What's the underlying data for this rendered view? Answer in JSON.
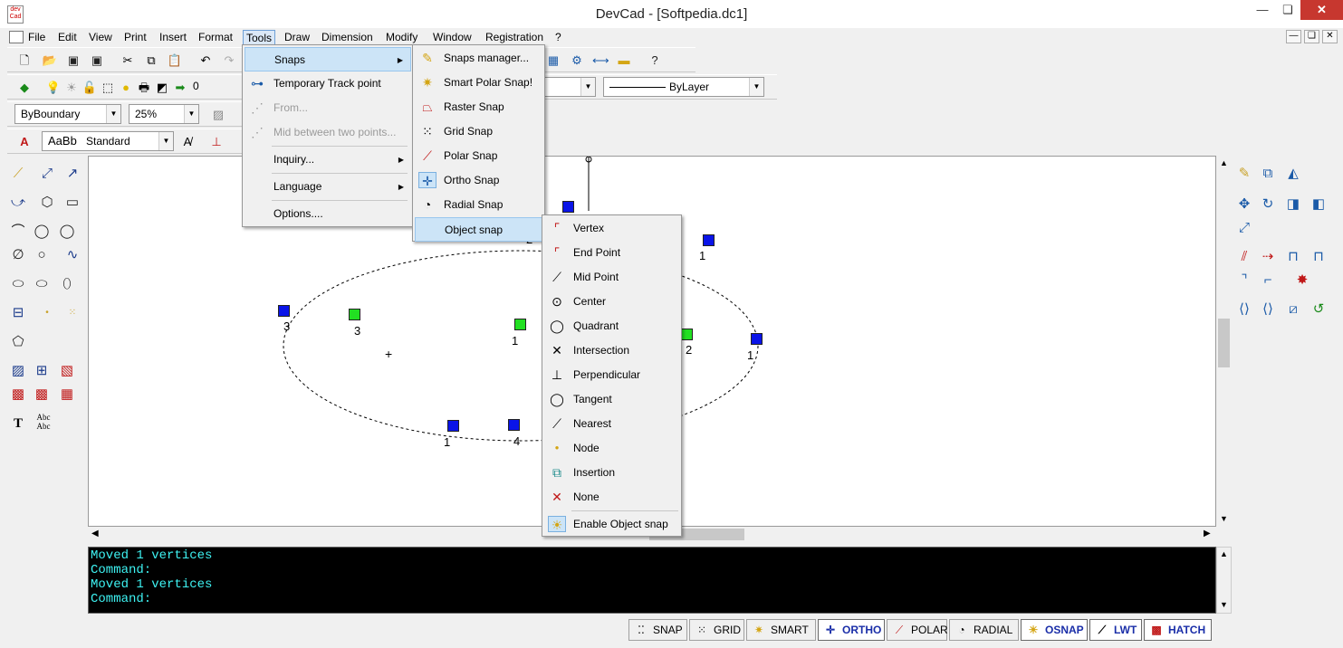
{
  "window": {
    "title": "DevCad - [Softpedia.dc1]",
    "app_icon_text": "dev\nCad"
  },
  "window_controls": {
    "minimize": "—",
    "restore": "❏",
    "close": "✕"
  },
  "mdi_controls": {
    "minimize": "—",
    "restore": "❏",
    "close": "✕"
  },
  "menu": [
    "File",
    "Edit",
    "View",
    "Print",
    "Insert",
    "Format",
    "Tools",
    "Draw",
    "Dimension",
    "Modify",
    "Window",
    "Registration",
    "?"
  ],
  "toolbar": {
    "layer_value": "0",
    "linetype_value": "ByLayer",
    "color_value": "r",
    "boundary_value": "ByBoundary",
    "zoom_value": "25%",
    "text_style_preview": "AaBb",
    "text_style_value": "Standard"
  },
  "tools_menu": {
    "items": [
      {
        "label": "Snaps",
        "icon": "snaps-icon",
        "submenu": true,
        "highlighted": true
      },
      {
        "label": "Temporary Track point",
        "icon": "track-point-icon"
      },
      {
        "label": "From...",
        "icon": "from-icon",
        "disabled": true
      },
      {
        "label": "Mid between two points...",
        "icon": "mid-between-icon",
        "disabled": true
      },
      {
        "label": "Inquiry...",
        "submenu": true
      },
      {
        "label": "Language",
        "submenu": true
      },
      {
        "label": "Options...."
      }
    ]
  },
  "snaps_menu": {
    "items": [
      {
        "label": "Snaps manager...",
        "icon": "snaps-manager-icon"
      },
      {
        "label": "Smart Polar Snap!",
        "icon": "smart-polar-icon"
      },
      {
        "label": "Raster Snap",
        "icon": "raster-snap-icon"
      },
      {
        "label": "Grid Snap",
        "icon": "grid-snap-icon"
      },
      {
        "label": "Polar Snap",
        "icon": "polar-snap-icon"
      },
      {
        "label": "Ortho Snap",
        "icon": "ortho-snap-icon"
      },
      {
        "label": "Radial Snap",
        "icon": "radial-snap-icon"
      },
      {
        "label": "Object snap",
        "submenu": true,
        "highlighted": true
      }
    ]
  },
  "osnap_menu": {
    "items": [
      {
        "label": "Vertex",
        "icon": "vertex-icon"
      },
      {
        "label": "End Point",
        "icon": "end-point-icon"
      },
      {
        "label": "Mid Point",
        "icon": "mid-point-icon"
      },
      {
        "label": "Center",
        "icon": "center-icon"
      },
      {
        "label": "Quadrant",
        "icon": "quadrant-icon"
      },
      {
        "label": "Intersection",
        "icon": "intersection-icon"
      },
      {
        "label": "Perpendicular",
        "icon": "perpendicular-icon"
      },
      {
        "label": "Tangent",
        "icon": "tangent-icon"
      },
      {
        "label": "Nearest",
        "icon": "nearest-icon"
      },
      {
        "label": "Node",
        "icon": "node-icon"
      },
      {
        "label": "Insertion",
        "icon": "insertion-icon"
      },
      {
        "label": "None",
        "icon": "none-icon"
      }
    ],
    "enable_label": "Enable Object snap"
  },
  "canvas": {
    "point_labels": [
      "3",
      "3",
      "1",
      "2",
      "1",
      "1",
      "1",
      "4",
      "2"
    ],
    "cursor": "+"
  },
  "command_lines": [
    "Moved 1 vertices",
    "Command:",
    "Moved 1 vertices",
    "Command:"
  ],
  "status_buttons": [
    {
      "label": "SNAP",
      "icon": "snap-icon",
      "on": false
    },
    {
      "label": "GRID",
      "icon": "grid-icon",
      "on": false
    },
    {
      "label": "SMART",
      "icon": "smart-icon",
      "on": false
    },
    {
      "label": "ORTHO",
      "icon": "ortho-icon",
      "on": true
    },
    {
      "label": "POLAR",
      "icon": "polar-icon",
      "on": false
    },
    {
      "label": "RADIAL",
      "icon": "radial-icon",
      "on": false
    },
    {
      "label": "OSNAP",
      "icon": "osnap-icon",
      "on": true
    },
    {
      "label": "LWT",
      "icon": "lwt-icon",
      "on": true
    },
    {
      "label": "HATCH",
      "icon": "hatch-icon",
      "on": true
    }
  ],
  "colors": {
    "accent": "#1a2ea8",
    "point_blue": "#0a14e8",
    "point_green": "#22e022",
    "command_text": "#3ef3f3"
  }
}
